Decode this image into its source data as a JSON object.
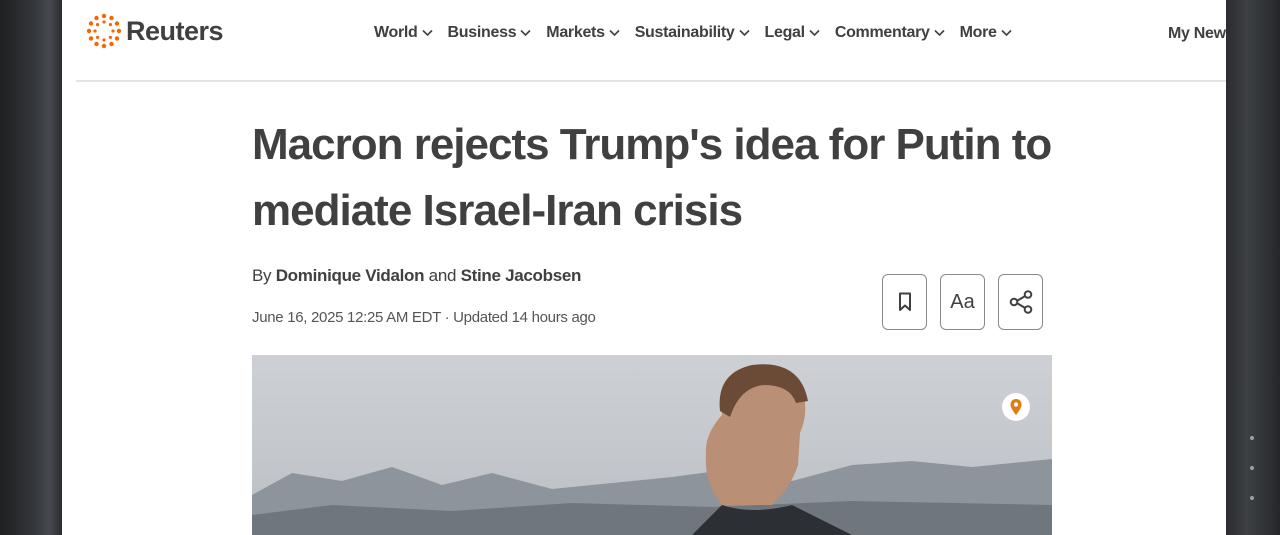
{
  "site": {
    "name": "Reuters",
    "brand_color": "#fa6400"
  },
  "nav": {
    "items": [
      {
        "label": "World"
      },
      {
        "label": "Business"
      },
      {
        "label": "Markets"
      },
      {
        "label": "Sustainability"
      },
      {
        "label": "Legal"
      },
      {
        "label": "Commentary"
      },
      {
        "label": "More"
      }
    ],
    "my_news": "My News"
  },
  "article": {
    "headline": "Macron rejects Trump's idea for Putin to mediate Israel-Iran crisis",
    "byline": {
      "prefix": "By",
      "author1": "Dominique Vidalon",
      "connector": "and",
      "author2": "Stine Jacobsen"
    },
    "date": "June 16, 2025 12:25 AM EDT · Updated 14 hours ago",
    "tools": {
      "bookmark_icon": "bookmark-icon",
      "text_size_label": "Aa",
      "share_icon": "share-icon"
    },
    "hero_image": {
      "location_icon": "location-pin-icon"
    }
  }
}
